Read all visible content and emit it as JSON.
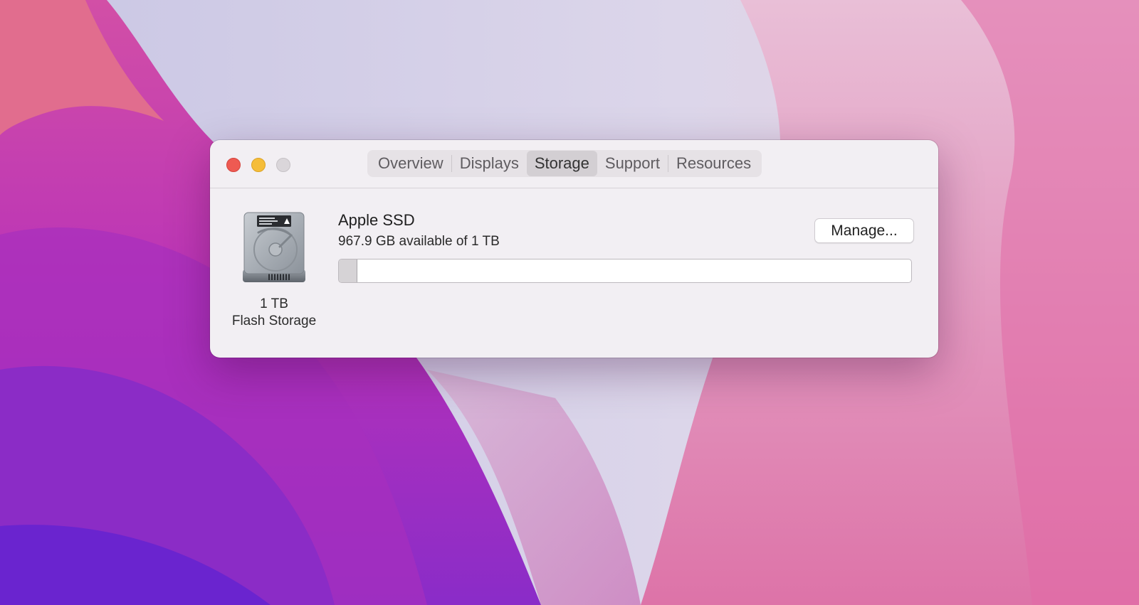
{
  "window": {
    "tabs": [
      {
        "label": "Overview",
        "active": false
      },
      {
        "label": "Displays",
        "active": false
      },
      {
        "label": "Storage",
        "active": true
      },
      {
        "label": "Support",
        "active": false
      },
      {
        "label": "Resources",
        "active": false
      }
    ],
    "traffic_lights": {
      "close_color": "#ee5a52",
      "minimize_color": "#f5bd39",
      "zoom_color": "#dad6da"
    }
  },
  "storage": {
    "disk_icon": "hard-drive-icon",
    "capacity_label": "1 TB",
    "type_label": "Flash Storage",
    "drive_name": "Apple SSD",
    "availability": "967.9 GB available of 1 TB",
    "manage_label": "Manage...",
    "used_fraction": 0.032
  }
}
